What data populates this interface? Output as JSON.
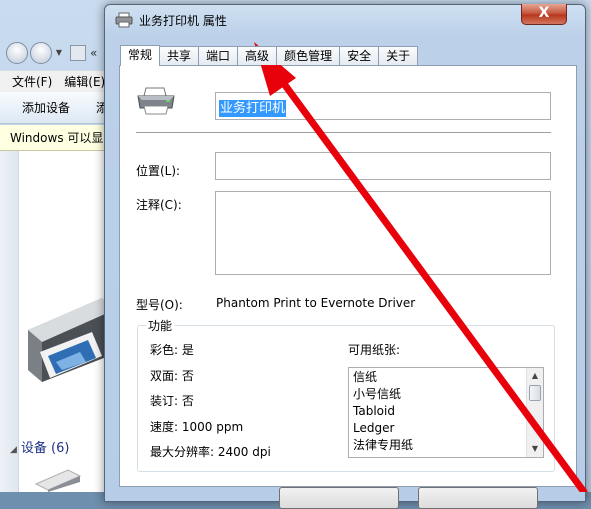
{
  "background_window": {
    "menu": [
      "文件(F)",
      "编辑(E)"
    ],
    "toolbar": [
      "添加设备",
      "添"
    ],
    "info_bar": "Windows 可以显",
    "group_header": "设备 (6)",
    "address_overflow": "«"
  },
  "dialog": {
    "title": "业务打印机 属性",
    "close_label": "X",
    "tabs": [
      "常规",
      "共享",
      "端口",
      "高级",
      "颜色管理",
      "安全",
      "关于"
    ],
    "active_tab": "常规",
    "printer_name": "业务打印机",
    "location_label": "位置(L):",
    "location_value": "",
    "comment_label": "注释(C):",
    "comment_value": "",
    "model_label": "型号(O):",
    "model_value": "Phantom Print to Evernote Driver",
    "features": {
      "title": "功能",
      "color": "彩色: 是",
      "duplex": "双面: 否",
      "staple": "装订: 否",
      "speed": "速度: 1000 ppm",
      "max_resolution": "最大分辨率: 2400 dpi",
      "paper_label": "可用纸张:",
      "paper_sizes": [
        "信纸",
        "小号信纸",
        "Tabloid",
        "Ledger",
        "法律专用纸"
      ]
    }
  },
  "annotation": {
    "arrow_color": "#e8000b"
  }
}
